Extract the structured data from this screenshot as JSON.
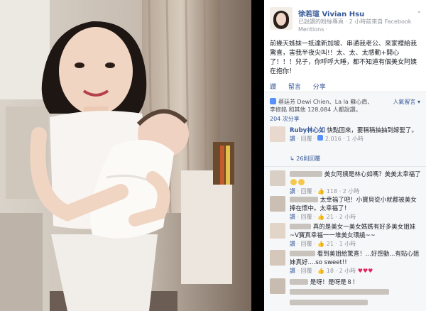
{
  "page": {
    "name": "徐若瑄 Vivian Hsu",
    "meta": "已說讚的粉絲專頁 · 2 小時前來自 Facebook Mentions ·",
    "chevron": "⌄"
  },
  "post": {
    "text": "前幾天姊妹一抵達新加坡、串通我老公、來家裡給我驚喜，害我半夜尖叫!！太、太、太感動+開心了！！！兒子，你呼呼大睡，都不知道有個美女阿姨在抱你！"
  },
  "actions": {
    "like": "讚",
    "comment": "留言",
    "share": "分享"
  },
  "likes": {
    "text": "蔡廷芳 Dewi Chien、La la 蘇心肩、李修銘 和其他 128,084 人都說讚。",
    "sort": "人氣留言 ▾"
  },
  "shares": {
    "text": "204 次分享"
  },
  "comments": [
    {
      "name": "Ruby林心如",
      "text": " 快點回來，要稱稱抽抽到嫁娶了。",
      "likes": "2,016",
      "time": "1 小時",
      "replies": "↳ 26則回覆"
    },
    {
      "name": "",
      "text": "美女阿姨是林心如嗎？美美太幸福了",
      "likes": "118",
      "time": "2 小時"
    },
    {
      "name": "",
      "text": "太幸福了吧！小寶貝從小就都被美女捧在懷中。太幸福了！",
      "likes": "21",
      "time": "2 小時"
    },
    {
      "name": "",
      "text": "真的是美女一美女媽媽有好多美女姐妹~V寶真幸福一一堆美女環繞~~",
      "likes": "21",
      "time": "1 小時"
    },
    {
      "name": "",
      "text": "看到美姐給驚喜！...好感動...有貼心姐妹真好....so sweet!!",
      "likes": "18",
      "time": "2 小時"
    },
    {
      "name": "",
      "text": "是呀！是呀是８！",
      "likes": "",
      "time": ""
    }
  ],
  "colors": {
    "link": "#365899",
    "feedback_bg": "#f6f7f9",
    "like_blue": "#5890ff"
  }
}
